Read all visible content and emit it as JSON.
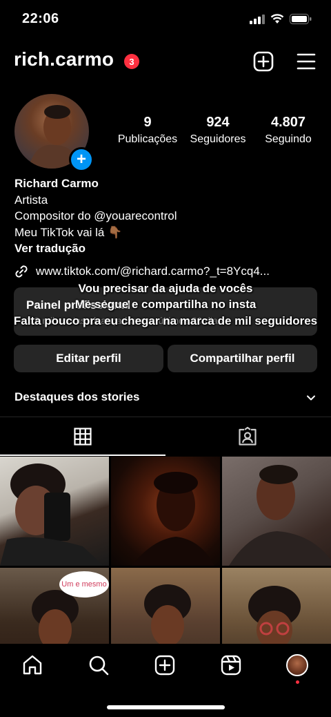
{
  "status_bar": {
    "time": "22:06"
  },
  "header": {
    "username": "rich.carmo",
    "notification_count": "3"
  },
  "stats": [
    {
      "value": "9",
      "label": "Publicações"
    },
    {
      "value": "924",
      "label": "Seguidores"
    },
    {
      "value": "4.807",
      "label": "Seguindo"
    }
  ],
  "bio": {
    "name": "Richard Carmo",
    "category": "Artista",
    "line1": "Compositor do @youarecontrol",
    "line2": "Meu TikTok vai lá 👇🏾",
    "translate": "Ver tradução",
    "link": "www.tiktok.com/@richard.carmo?_t=8Ycq4..."
  },
  "dashboard": {
    "title": "Painel profissional",
    "subtitle": "1,2 mil contas alcançadas nos últimos 30 dias"
  },
  "overlay_caption": [
    "Vou precisar da ajuda de vocês",
    "Me segue e compartilha no insta",
    "Falta pouco pra eu chegar na marca de mil seguidores"
  ],
  "buttons": {
    "edit": "Editar perfil",
    "share": "Compartilhar perfil"
  },
  "highlights": {
    "label": "Destaques dos stories"
  },
  "posts": {
    "bubble_text": "Um e mesmo"
  },
  "colors": {
    "accent": "#0095f6",
    "badge": "#ff3040",
    "surface": "#262626"
  }
}
